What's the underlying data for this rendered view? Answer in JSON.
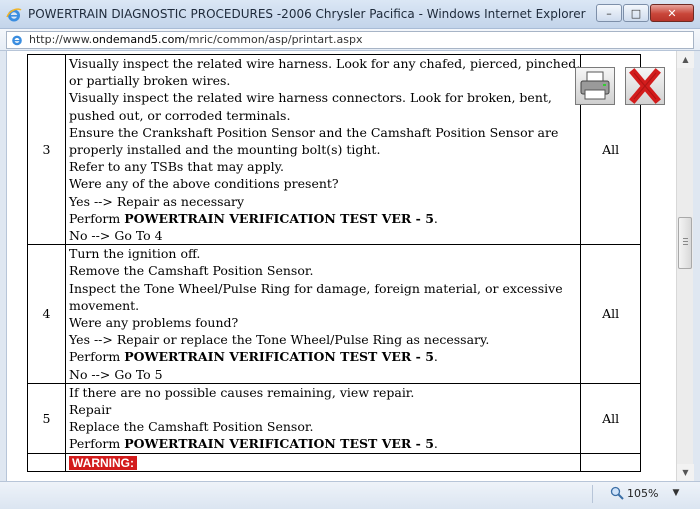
{
  "window": {
    "title": "POWERTRAIN DIAGNOSTIC PROCEDURES -2006 Chrysler Pacifica - Windows Internet Explorer",
    "minimize": "–",
    "maximize": "□",
    "close": "✕"
  },
  "address": {
    "prefix": "http://www.",
    "host": "ondemand5.com",
    "path": "/mric/common/asp/printart.aspx"
  },
  "steps": [
    {
      "number": "3",
      "applies": "All",
      "lines": [
        {
          "text": "Visually inspect the related wire harness. Look for any chafed, pierced, pinched,"
        },
        {
          "text": "or partially broken wires."
        },
        {
          "text": "Visually inspect the related wire harness connectors. Look for broken, bent,"
        },
        {
          "text": "pushed out, or corroded terminals."
        },
        {
          "text": "Ensure the Crankshaft Position Sensor and the Camshaft Position Sensor are"
        },
        {
          "text": "properly installed and the mounting bolt(s) tight."
        },
        {
          "text": "Refer to any TSBs that may apply."
        },
        {
          "text": "Were any of the above conditions present?"
        },
        {
          "text": "Yes --> Repair as necessary"
        },
        {
          "prefix": "Perform ",
          "bold": "POWERTRAIN VERIFICATION TEST VER - 5",
          "suffix": "."
        },
        {
          "text": "No --> Go To 4"
        }
      ]
    },
    {
      "number": "4",
      "applies": "All",
      "lines": [
        {
          "text": "Turn the ignition off."
        },
        {
          "text": "Remove the Camshaft Position Sensor."
        },
        {
          "text": "Inspect the Tone Wheel/Pulse Ring for damage, foreign material, or excessive"
        },
        {
          "text": "movement."
        },
        {
          "text": "Were any problems found?"
        },
        {
          "text": "Yes --> Repair or replace the Tone Wheel/Pulse Ring as necessary."
        },
        {
          "prefix": "Perform ",
          "bold": "POWERTRAIN VERIFICATION TEST VER - 5",
          "suffix": "."
        },
        {
          "text": "No --> Go To 5"
        }
      ]
    },
    {
      "number": "5",
      "applies": "All",
      "lines": [
        {
          "text": "If there are no possible causes remaining, view repair."
        },
        {
          "text": "Repair"
        },
        {
          "text": "Replace the Camshaft Position Sensor."
        },
        {
          "prefix": "Perform ",
          "bold": "POWERTRAIN VERIFICATION TEST VER - 5",
          "suffix": "."
        }
      ]
    }
  ],
  "warning_label": "WARNING:",
  "tools": {
    "print_icon": "printer-icon",
    "close_icon": "red-x-icon"
  },
  "status": {
    "zoom": "105%"
  },
  "colors": {
    "warning": "#d31c1c",
    "close_x": "#d31c1c"
  }
}
